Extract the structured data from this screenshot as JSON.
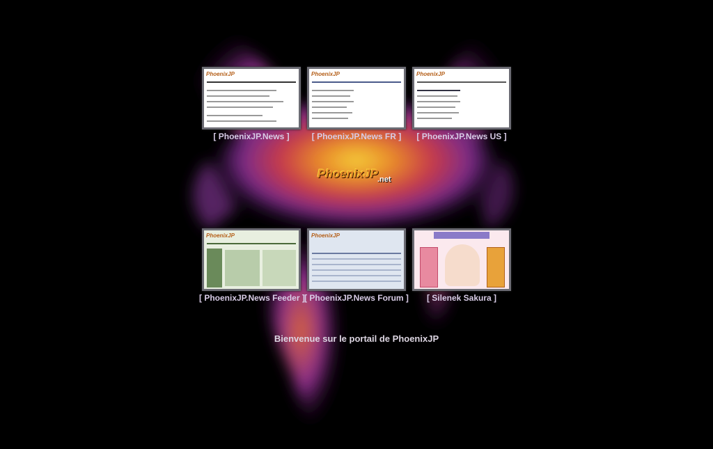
{
  "portal": {
    "welcome": "Bienvenue sur le portail de PhoenixJP",
    "logo_text": "PhoenixJP",
    "logo_suffix": ".net"
  },
  "sites": [
    {
      "label": "[ PhoenixJP.News ]",
      "thumb_title": "PhoenixJP"
    },
    {
      "label": "[ PhoenixJP.News FR ]",
      "thumb_title": "PhoenixJP"
    },
    {
      "label": "[ PhoenixJP.News US ]",
      "thumb_title": "PhoenixJP"
    },
    {
      "label": "[ PhoenixJP.News Feeder ]",
      "thumb_title": "PhoenixJP"
    },
    {
      "label": "[ PhoenixJP.News Forum ]",
      "thumb_title": "PhoenixJP"
    },
    {
      "label": "[ Silenek Sakura ]",
      "thumb_title": ""
    }
  ],
  "colors": {
    "background": "#000000",
    "label": "#d8cce6",
    "thumb_border": "#6b6b73"
  }
}
